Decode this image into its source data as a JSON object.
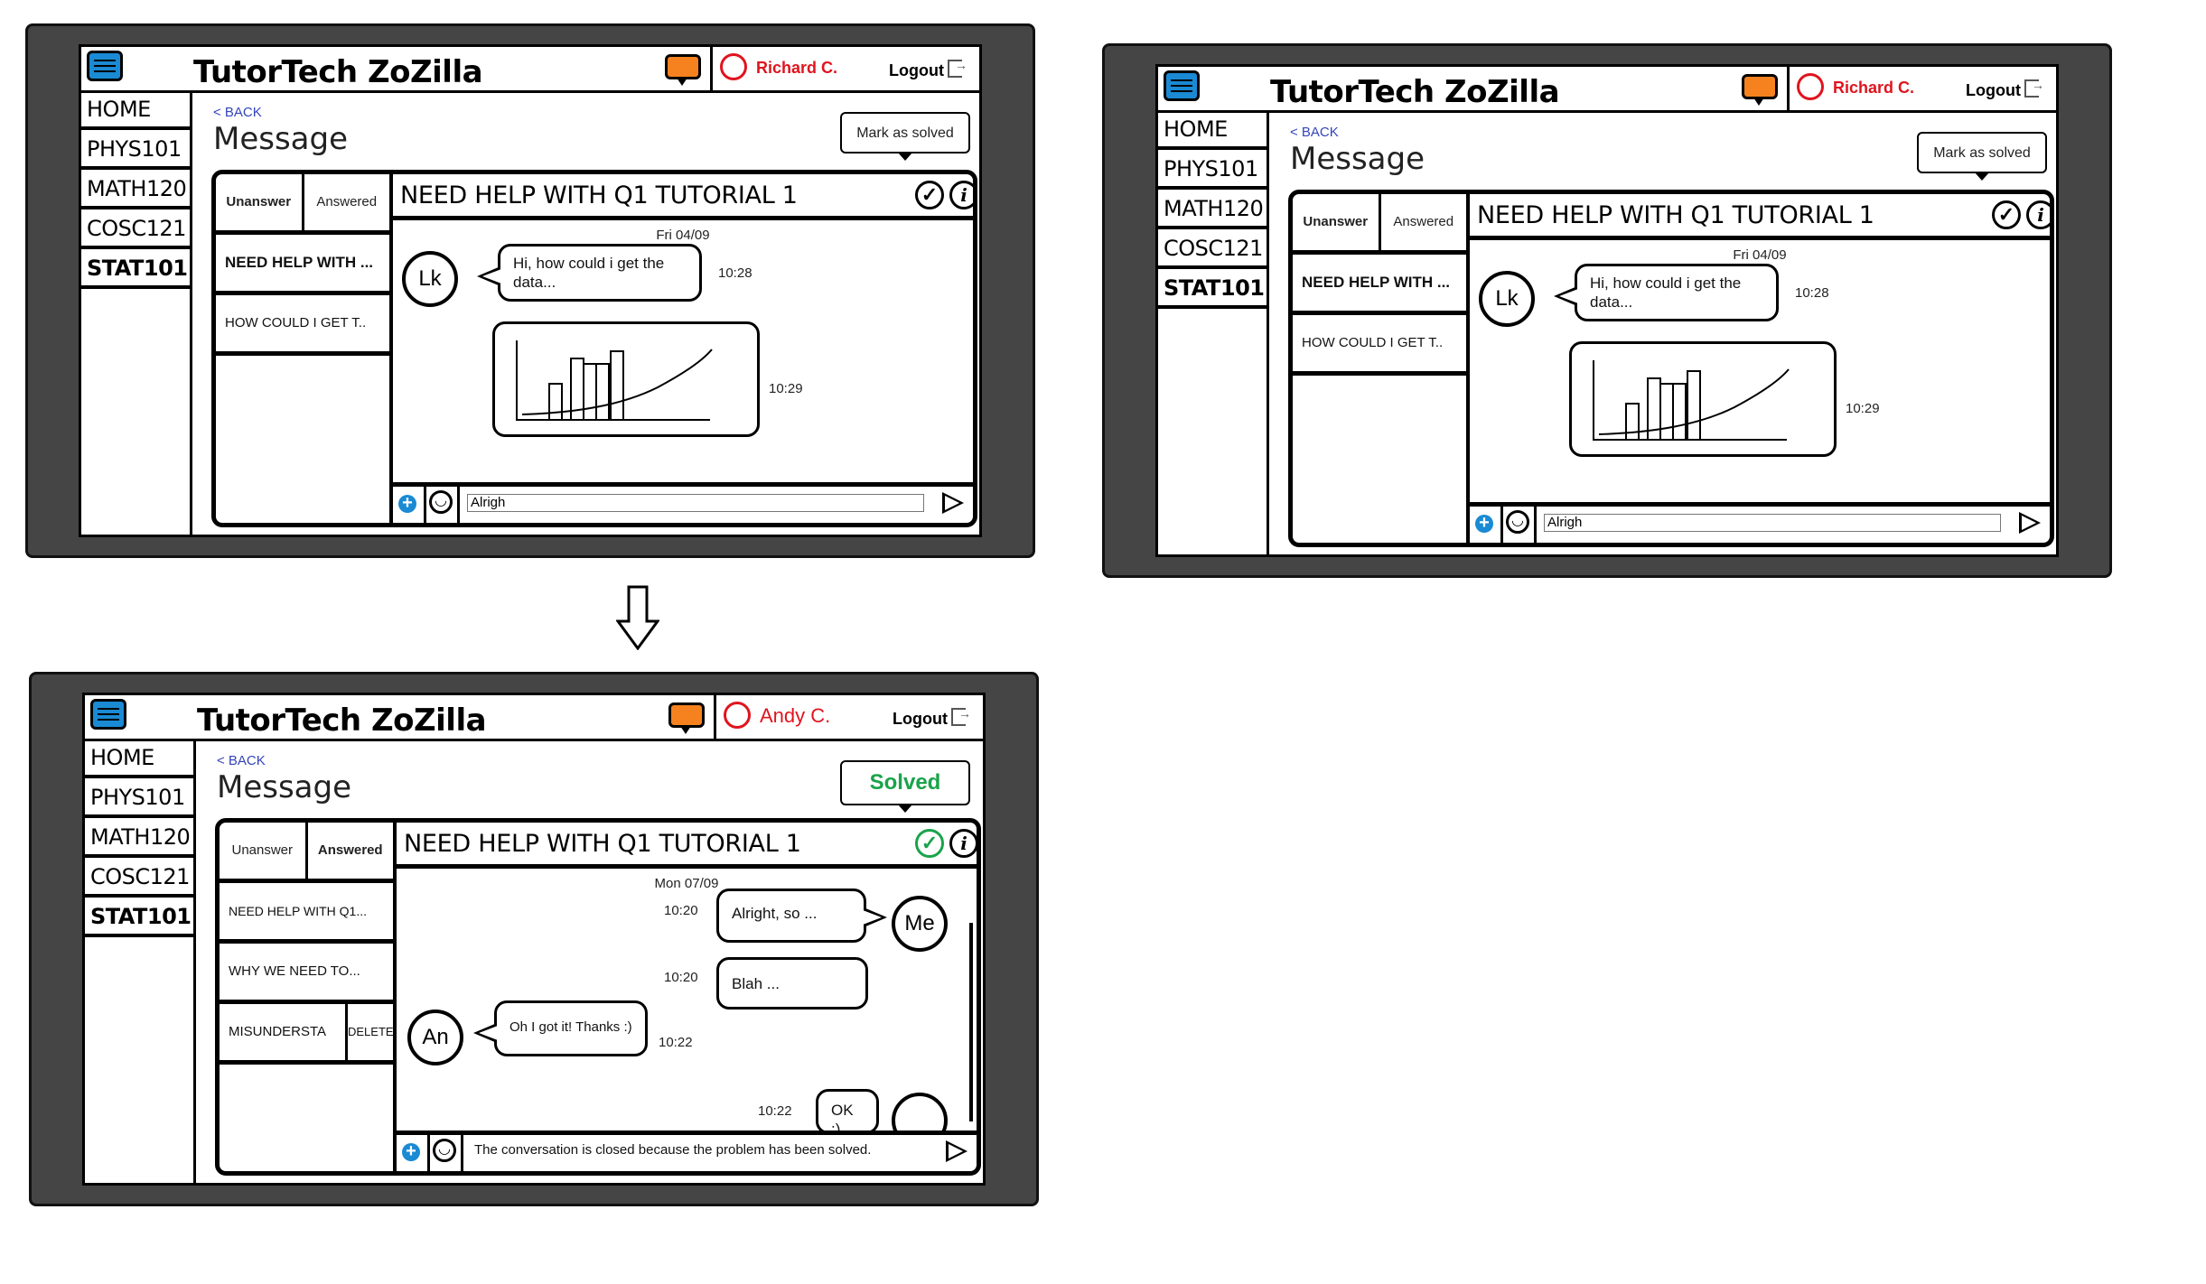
{
  "colors": {
    "accent_blue": "#1a8ad4",
    "chat_orange": "#f5821f",
    "user_red": "#e0141e",
    "solved_green": "#1aa34a",
    "frame_gray": "#454545"
  },
  "screens": [
    {
      "app_title": "TutorTech ZoZilla",
      "user_name": "Richard C.",
      "logout": "Logout",
      "nav": [
        "HOME",
        "PHYS101",
        "MATH120",
        "COSC121",
        "STAT101"
      ],
      "back": "< BACK",
      "page_title": "Message",
      "status_button": "Mark as solved",
      "tabs": [
        "Unanswer",
        "Answered"
      ],
      "threads": [
        "NEED HELP WITH ...",
        "HOW COULD I GET T.."
      ],
      "chat_title": "NEED HELP WITH Q1 TUTORIAL 1",
      "date": "Fri 04/09",
      "avatar": "Lk",
      "message_text": "Hi, how could i get the data...",
      "message_time": "10:28",
      "image_time": "10:29",
      "input_value": "Alrigh"
    },
    {
      "app_title": "TutorTech ZoZilla",
      "user_name": "Richard C.",
      "logout": "Logout",
      "nav": [
        "HOME",
        "PHYS101",
        "MATH120",
        "COSC121",
        "STAT101"
      ],
      "back": "< BACK",
      "page_title": "Message",
      "status_button": "Mark as solved",
      "tabs": [
        "Unanswer",
        "Answered"
      ],
      "threads": [
        "NEED HELP WITH ...",
        "HOW COULD I GET T.."
      ],
      "chat_title": "NEED HELP WITH Q1 TUTORIAL 1",
      "date": "Fri 04/09",
      "avatar": "Lk",
      "message_text": "Hi, how could i get the data...",
      "message_time": "10:28",
      "image_time": "10:29",
      "input_value": "Alrigh"
    },
    {
      "app_title": "TutorTech ZoZilla",
      "user_name": "Andy C.",
      "logout": "Logout",
      "nav": [
        "HOME",
        "PHYS101",
        "MATH120",
        "COSC121",
        "STAT101"
      ],
      "back": "< BACK",
      "page_title": "Message",
      "status_button": "Solved",
      "tabs": [
        "Unanswer",
        "Answered"
      ],
      "threads": [
        "NEED HELP WITH Q1...",
        "WHY WE NEED TO...",
        "MISUNDERSTA"
      ],
      "delete_label": "DELETE",
      "chat_title": "NEED HELP WITH Q1 TUTORIAL 1",
      "date": "Mon 07/09",
      "me_avatar": "Me",
      "other_avatar": "An",
      "messages": [
        {
          "text": "Alright, so ...",
          "time": "10:20"
        },
        {
          "text": "Blah ...",
          "time": "10:20"
        },
        {
          "text": "Oh I got it! Thanks :)",
          "time": "10:22"
        },
        {
          "text": "OK :)",
          "time": "10:22"
        }
      ],
      "closed_notice": "The conversation is closed because the problem has been solved."
    }
  ]
}
